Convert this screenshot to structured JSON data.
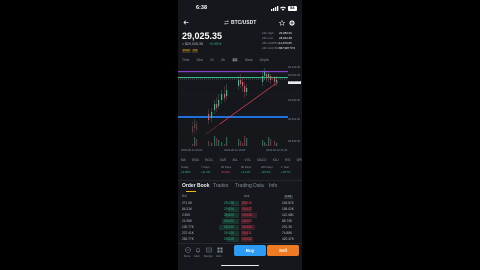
{
  "status": {
    "time": "6:38",
    "battery": "53"
  },
  "header": {
    "pair": "BTC/USDT"
  },
  "price": {
    "last": "29,025.35",
    "fiat": "≈ $29,025.35",
    "change": "+0.05%",
    "tags": [
      "PoW",
      "Vol"
    ]
  },
  "stats": {
    "labels": [
      "24h High",
      "24h Low",
      "24h Vol(BTC)",
      "24h Vol(USDT)"
    ],
    "values": [
      "29,080.00",
      "28,942.38",
      "11,979.65",
      "347,987,574"
    ]
  },
  "timeframes": [
    "Time",
    "15m",
    "1h",
    "4h",
    "1D",
    "More",
    "Depth"
  ],
  "chart": {
    "price_labels": [
      "29,100.00",
      "29,060.00",
      "29,025.35",
      "29,000.00",
      "28,960.00",
      "28,940.00"
    ],
    "time_labels": [
      "2023-06-12 09:00",
      "2023-06-12 15:00",
      "2023-06-12 21:00"
    ]
  },
  "indicators": [
    "MA",
    "EMA",
    "BOLL",
    "SAR",
    "AVL",
    "VOL",
    "MACD",
    "KDJ",
    "RSI",
    "WR"
  ],
  "trade_rows": [
    {
      "label": "Today",
      "value": "+0.05%"
    },
    {
      "label": "7 Days",
      "value": "+11.2%"
    },
    {
      "label": "30 Days",
      "value": "-8.42%"
    },
    {
      "label": "90 Days",
      "value": "+3.11%"
    },
    {
      "label": "180 Days",
      "value": "+35.4%"
    },
    {
      "label": "1 Year",
      "value": "+18.7%"
    }
  ],
  "tabs": [
    "Order Book",
    "Trades",
    "Trading Data",
    "Info"
  ],
  "orderbook": {
    "headers": [
      "Bid",
      "Ask"
    ],
    "precision": "0.01",
    "rows": [
      {
        "bid_qty": "271.5K",
        "bid": "29,025",
        "ask": "29,026",
        "ask_qty": "163.87K"
      },
      {
        "bid_qty": "84.31K",
        "bid": "29,024",
        "ask": "29,027",
        "ask_qty": "156.02K"
      },
      {
        "bid_qty": "2.92K",
        "bid": "29,023",
        "ask": "29,028",
        "ask_qty": "112.45K"
      },
      {
        "bid_qty": "21.95K",
        "bid": "29,022",
        "ask": "29,029",
        "ask_qty": "88.73K"
      },
      {
        "bid_qty": "130.77K",
        "bid": "29,021",
        "ask": "29,030",
        "ask_qty": "201.3K"
      },
      {
        "bid_qty": "237.41K",
        "bid": "29,020",
        "ask": "29,031",
        "ask_qty": "74.88K"
      },
      {
        "bid_qty": "263.77K",
        "bid": "29,019",
        "ask": "29,032",
        "ask_qty": "420.47K"
      }
    ]
  },
  "bottom": {
    "icons": [
      "More",
      "Alert",
      "Margin",
      "Grid"
    ],
    "buy": "Buy",
    "sell": "Sell"
  }
}
